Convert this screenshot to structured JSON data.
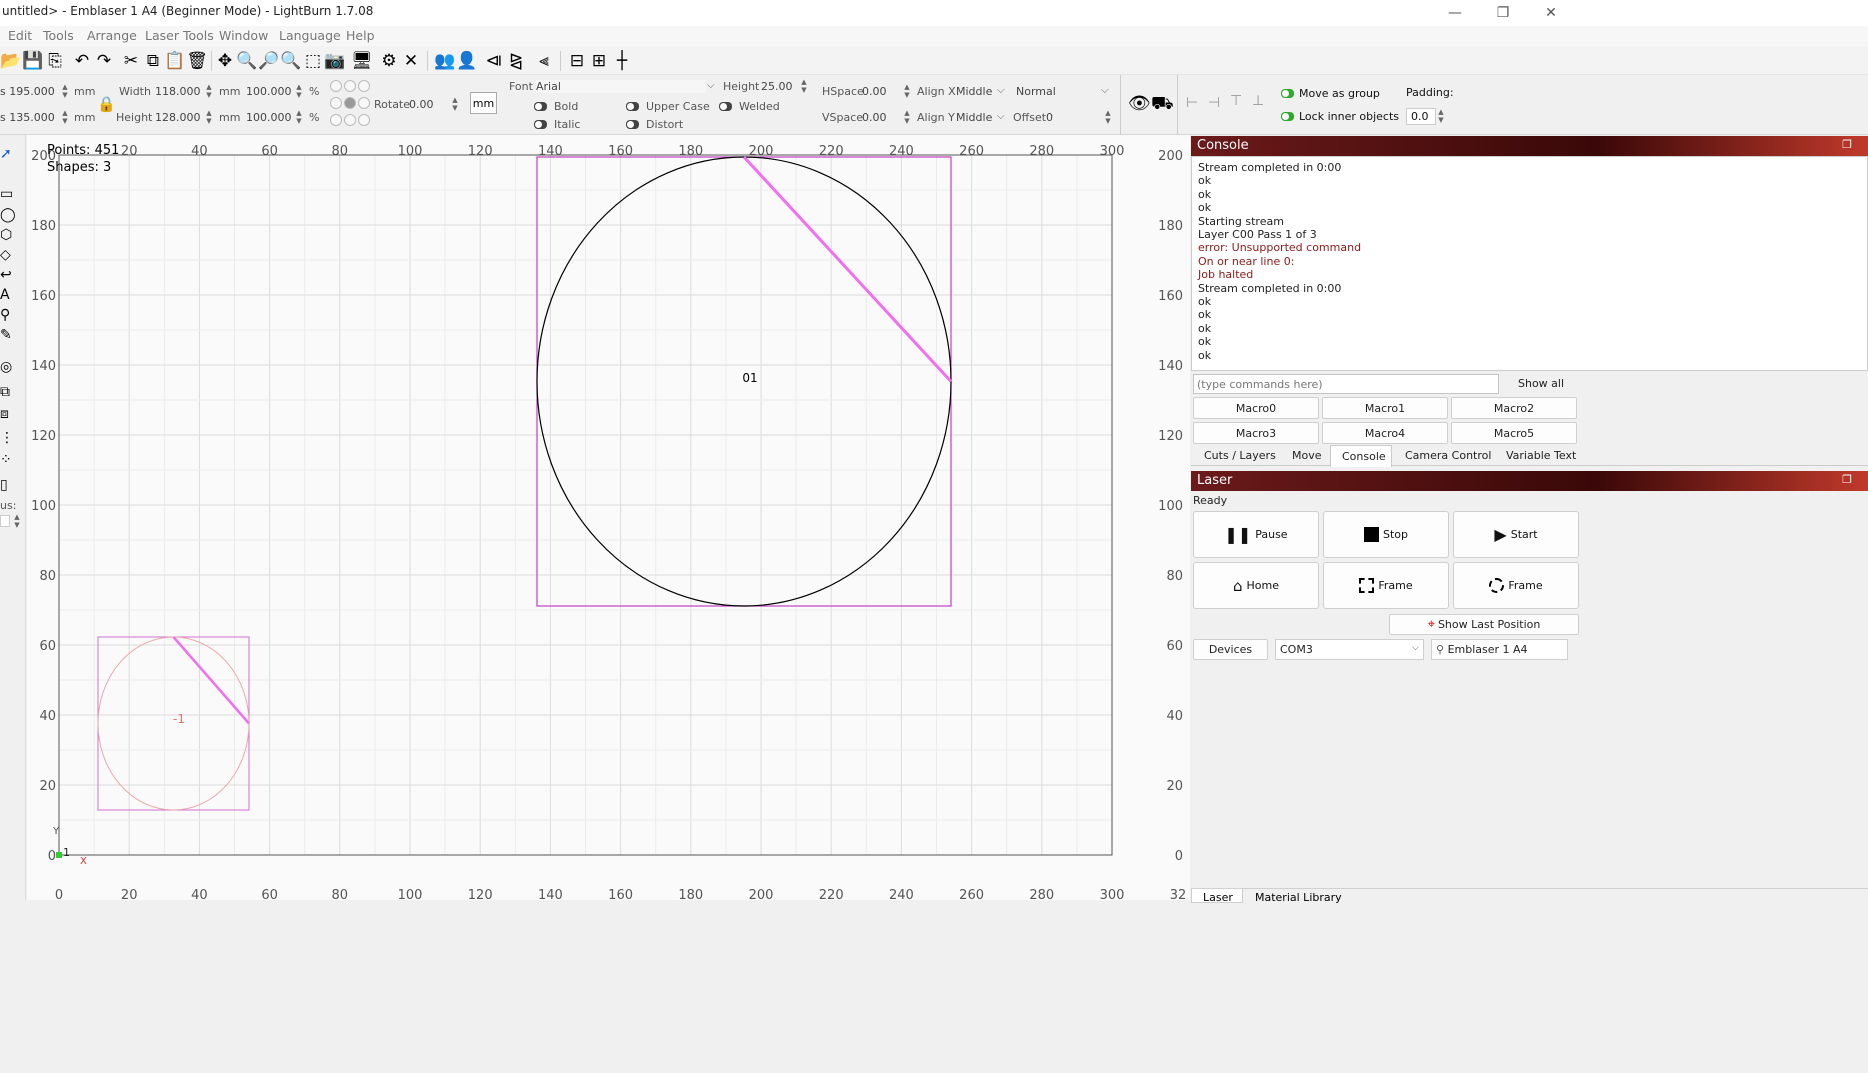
{
  "window": {
    "title": "untitled> - Emblaser 1 A4 (Beginner Mode) - LightBurn 1.7.08",
    "controls": {
      "minimize": "—",
      "restore": "❐",
      "close": "✕"
    }
  },
  "menu": [
    "Edit",
    "Tools",
    "Arrange",
    "Laser Tools",
    "Window",
    "Language",
    "Help"
  ],
  "props": {
    "x_value": "s 195.000",
    "y_value": "s 135.000",
    "unit_x": "mm",
    "unit_y": "mm",
    "width_label": "Width",
    "width_value": "118.000",
    "height_label": "Height",
    "height_value": "128.000",
    "width_unit": "mm",
    "height_unit": "mm",
    "width_pct": "100.000",
    "height_pct": "100.000",
    "pct_sym": "%",
    "rotate_label": "Rotate",
    "rotate_value": "0.00",
    "mm_button": "mm",
    "font_label": "Font",
    "font_value": "Arial",
    "text_height_label": "Height",
    "text_height_value": "25.00",
    "hspace_label": "HSpace",
    "hspace_value": "0.00",
    "vspace_label": "VSpace",
    "vspace_value": "0.00",
    "alignx_label": "Align X",
    "alignx_value": "Middle",
    "aligny_label": "Align Y",
    "aligny_value": "Middle",
    "mode_value": "Normal",
    "offset_label": "Offset",
    "offset_value": "0",
    "bold": "Bold",
    "italic": "Italic",
    "upper": "Upper Case",
    "distort": "Distort",
    "welded": "Welded",
    "move_as_group": "Move as group",
    "lock_inner": "Lock inner objects",
    "padding_label": "Padding:",
    "padding_value": "0.0"
  },
  "canvas": {
    "points": "Points: 451",
    "shapes": "Shapes: 3",
    "shape_label_big": "01",
    "shape_label_small": "-1",
    "axis_y_marker": "Y",
    "axis_x_marker": "X",
    "origin_marker": "1",
    "x_ticks": [
      "20",
      "40",
      "60",
      "80",
      "100",
      "120",
      "140",
      "160",
      "180",
      "200",
      "220",
      "240",
      "260",
      "280",
      "300"
    ],
    "x_ticks_bottom": [
      "0",
      "20",
      "40",
      "60",
      "80",
      "100",
      "120",
      "140",
      "160",
      "180",
      "200",
      "220",
      "240",
      "260",
      "280",
      "300",
      "32"
    ],
    "y_ticks": [
      "200",
      "180",
      "160",
      "140",
      "120",
      "100",
      "80",
      "60",
      "40",
      "20",
      "0"
    ],
    "colors": {
      "selection": "#c040c0",
      "line": "#f070f0",
      "circle": "#000000",
      "small_circle": "#e8a0a0"
    }
  },
  "left": {
    "radius_label": "us:"
  },
  "console": {
    "title": "Console",
    "lines": [
      {
        "text": "Stream completed in 0:00",
        "color": "#222222"
      },
      {
        "text": "ok",
        "color": "#222222"
      },
      {
        "text": "ok",
        "color": "#222222"
      },
      {
        "text": "ok",
        "color": "#222222"
      },
      {
        "text": "Starting stream",
        "color": "#222222"
      },
      {
        "text": "Layer C00 Pass 1 of 3",
        "color": "#222222"
      },
      {
        "text": "error: Unsupported command",
        "color": "#8b1a1a"
      },
      {
        "text": "On or near line 0:",
        "color": "#8b1a1a"
      },
      {
        "text": "Job halted",
        "color": "#8b1a1a"
      },
      {
        "text": "Stream completed in 0:00",
        "color": "#222222"
      },
      {
        "text": "ok",
        "color": "#222222"
      },
      {
        "text": "ok",
        "color": "#222222"
      },
      {
        "text": "ok",
        "color": "#222222"
      },
      {
        "text": "ok",
        "color": "#222222"
      },
      {
        "text": "ok",
        "color": "#222222"
      }
    ],
    "input_placeholder": "(type commands here)",
    "show_all": "Show all",
    "macros": [
      "Macro0",
      "Macro1",
      "Macro2",
      "Macro3",
      "Macro4",
      "Macro5"
    ],
    "tabs": [
      "Cuts / Layers",
      "Move",
      "Console",
      "Camera Control",
      "Variable Text"
    ]
  },
  "laser": {
    "title": "Laser",
    "status": "Ready",
    "pause": "Pause",
    "stop": "Stop",
    "start": "Start",
    "home": "Home",
    "frame1": "Frame",
    "frame2": "Frame",
    "show_last": "Show Last Position",
    "devices": "Devices",
    "port": "COM3",
    "device": "Emblaser 1 A4",
    "bottom_tabs": [
      "Laser",
      "Material Library"
    ]
  }
}
